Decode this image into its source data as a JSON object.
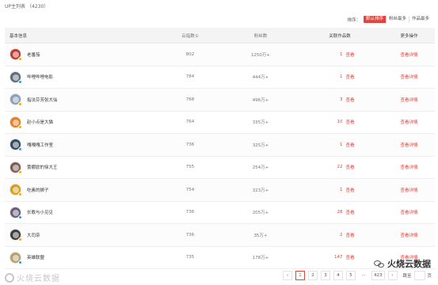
{
  "panel": {
    "title": "UP主列表",
    "count": "（4230）"
  },
  "sort": {
    "label": "排序：",
    "options": [
      "默认排序",
      "粉丝最多",
      "作品最多"
    ],
    "active_color": "#e0443e"
  },
  "table": {
    "headers": {
      "name": "基本信息",
      "index": "云指数①",
      "fans": "粉丝数",
      "works": "关联作品数",
      "more": "更多操作"
    },
    "rows": [
      {
        "name": "老番茄",
        "index": "802",
        "fans": "1250万+",
        "works": "1",
        "view": "查看",
        "detail": "查看详情",
        "avatar_color": "#c0392b",
        "badge_color": "#f0b000"
      },
      {
        "name": "哔哩哔哩电影",
        "index": "784",
        "fans": "444万+",
        "works": "1",
        "view": "查看",
        "detail": "查看详情",
        "avatar_color": "#5f6b7a",
        "badge_color": "#2e9cdb"
      },
      {
        "name": "指法芬芳张大仙",
        "index": "768",
        "fans": "496万+",
        "works": "3",
        "view": "查看",
        "detail": "查看详情",
        "avatar_color": "#8aa0b8",
        "badge_color": "#f0b000"
      },
      {
        "name": "赵小点是大猫",
        "index": "764",
        "fans": "335万+",
        "works": "10",
        "view": "查看",
        "detail": "查看详情",
        "avatar_color": "#e67e22",
        "badge_color": "#f0b000"
      },
      {
        "name": "嘎嘎嘎工作室",
        "index": "736",
        "fans": "325万+",
        "works": "1",
        "view": "查看",
        "detail": "查看详情",
        "avatar_color": "#34495e",
        "badge_color": "#2e9cdb"
      },
      {
        "name": "蕾娜欧的徐大王",
        "index": "755",
        "fans": "254万+",
        "works": "22",
        "view": "查看",
        "detail": "查看详情",
        "avatar_color": "#7d5a50",
        "badge_color": "#f0b000"
      },
      {
        "name": "吃素的狮子",
        "index": "754",
        "fans": "323万+",
        "works": "1",
        "view": "查看",
        "detail": "查看详情",
        "avatar_color": "#d4a017",
        "badge_color": "#f0b000"
      },
      {
        "name": "长歌与小见见",
        "index": "736",
        "fans": "205万+",
        "works": "28",
        "view": "查看",
        "detail": "查看详情",
        "avatar_color": "#6c5b7b",
        "badge_color": "#2e9cdb"
      },
      {
        "name": "大司奈",
        "index": "736",
        "fans": "35万+",
        "works": "2",
        "view": "查看",
        "detail": "查看详情",
        "avatar_color": "#3d3d3d",
        "badge_color": "#f0b000"
      },
      {
        "name": "英雄联盟",
        "index": "735",
        "fans": "178万+",
        "works": "147",
        "view": "查看",
        "detail": "查看详情",
        "avatar_color": "#b8a06a",
        "badge_color": "#2e9cdb"
      }
    ]
  },
  "pagination": {
    "prev": "‹",
    "pages": [
      "1",
      "2",
      "3",
      "4",
      "5"
    ],
    "active_page": "1",
    "ellipsis": "···",
    "total_pages": "423",
    "next": "›",
    "jump_label": "跳至",
    "jump_suffix": "页"
  },
  "watermarks": {
    "left": "火烧云数据",
    "right": "火烧云数据"
  }
}
